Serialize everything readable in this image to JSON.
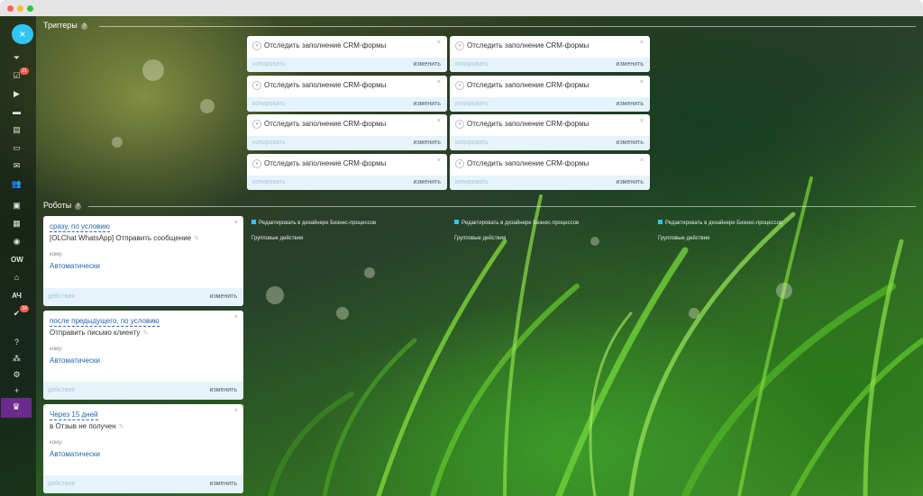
{
  "window": {
    "dots": [
      "#ff5f57",
      "#febc2e",
      "#28c840"
    ]
  },
  "sidebar": {
    "close_icon": "×",
    "items": [
      {
        "icon": "filter-icon",
        "glyph": "⏷"
      },
      {
        "icon": "tasks-icon",
        "glyph": "☑",
        "badge": "21"
      },
      {
        "icon": "feed-icon",
        "glyph": "▶"
      },
      {
        "icon": "chat-icon",
        "glyph": "▬"
      },
      {
        "icon": "calendar-icon",
        "glyph": "▤"
      },
      {
        "icon": "drive-icon",
        "glyph": "▭"
      },
      {
        "icon": "mail-icon",
        "glyph": "✉"
      },
      {
        "icon": "team-icon",
        "glyph": "👥"
      },
      {
        "icon": "card-icon",
        "glyph": "▣"
      },
      {
        "icon": "store-icon",
        "glyph": "▦"
      },
      {
        "icon": "target-icon",
        "glyph": "◉"
      },
      {
        "icon": "ow-icon",
        "glyph": "OW"
      },
      {
        "icon": "home-icon",
        "glyph": "⌂"
      },
      {
        "icon": "ach-icon",
        "glyph": "АЧ"
      },
      {
        "icon": "check-icon",
        "glyph": "✔",
        "badge": "34"
      },
      {
        "icon": "help-icon",
        "glyph": "?"
      },
      {
        "icon": "sitemap-icon",
        "glyph": "⁂"
      },
      {
        "icon": "settings-icon",
        "glyph": "⚙"
      },
      {
        "icon": "plus-icon",
        "glyph": "+"
      }
    ],
    "bottom_icon": "crown-icon",
    "bottom_glyph": "♛"
  },
  "triggers": {
    "title": "Триггеры",
    "items": [
      {
        "label": "Отследить заполнение CRM-формы",
        "copy": "копировать",
        "edit": "изменить"
      },
      {
        "label": "Отследить заполнение CRM-формы",
        "copy": "копировать",
        "edit": "изменить"
      },
      {
        "label": "Отследить заполнение CRM-формы",
        "copy": "копировать",
        "edit": "изменить"
      },
      {
        "label": "Отследить заполнение CRM-формы",
        "copy": "копировать",
        "edit": "изменить"
      },
      {
        "label": "Отследить заполнение CRM-формы",
        "copy": "копировать",
        "edit": "изменить"
      },
      {
        "label": "Отследить заполнение CRM-формы",
        "copy": "копировать",
        "edit": "изменить"
      },
      {
        "label": "Отследить заполнение CRM-формы",
        "copy": "копировать",
        "edit": "изменить"
      },
      {
        "label": "Отследить заполнение CRM-формы",
        "copy": "копировать",
        "edit": "изменить"
      }
    ]
  },
  "robots": {
    "title": "Роботы",
    "items": [
      {
        "condition": "сразу, по условию",
        "title": "[OLChat WhatsApp] Отправить сообщение",
        "to_label": "кому:",
        "to_value": "Автоматически",
        "actions": "действия",
        "edit": "изменить"
      },
      {
        "condition": "после предыдущего, по условию",
        "title": "Отправить письмо клиенту",
        "to_label": "кому:",
        "to_value": "Автоматически",
        "actions": "действия",
        "edit": "изменить"
      },
      {
        "condition": "Через 15 дней",
        "title": "в Отзыв не получен",
        "to_label": "кому:",
        "to_value": "Автоматически",
        "actions": "действия",
        "edit": "изменить"
      }
    ],
    "columns": [
      {
        "designer_link": "Редактировать в дизайнере Бизнес-процессов",
        "group_actions": "Групповые действия"
      },
      {
        "designer_link": "Редактировать в дизайнере Бизнес-процессов",
        "group_actions": "Групповые действия"
      },
      {
        "designer_link": "Редактировать в дизайнере Бизнес-процессов",
        "group_actions": "Групповые действия"
      }
    ]
  },
  "colors": {
    "accent": "#2fc6f6",
    "link": "#2067b0",
    "footer": "#e5f4fb",
    "badge": "#ff5752"
  }
}
